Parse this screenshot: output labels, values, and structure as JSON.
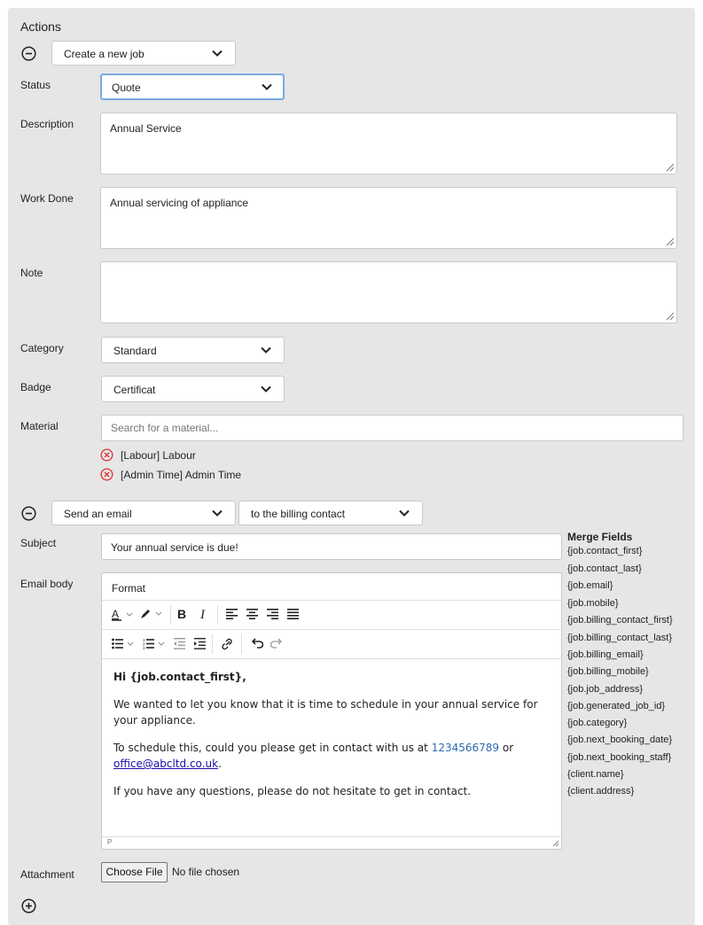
{
  "section_title": "Actions",
  "action1": {
    "select_value": "Create a new job"
  },
  "job_form": {
    "status": {
      "label": "Status",
      "value": "Quote"
    },
    "description": {
      "label": "Description",
      "value": "Annual Service"
    },
    "work_done": {
      "label": "Work Done",
      "value": "Annual servicing of appliance"
    },
    "note": {
      "label": "Note",
      "value": ""
    },
    "category": {
      "label": "Category",
      "value": "Standard"
    },
    "badge": {
      "label": "Badge",
      "value": "Certificat"
    },
    "material": {
      "label": "Material",
      "placeholder": "Search for a material...",
      "items": [
        "[Labour] Labour",
        "[Admin Time] Admin Time"
      ]
    }
  },
  "action2": {
    "select_value": "Send an email",
    "recipient_value": "to the billing contact"
  },
  "email_form": {
    "subject": {
      "label": "Subject",
      "value": "Your annual service is due!"
    },
    "body": {
      "label": "Email body",
      "format_label": "Format",
      "status_path": "P",
      "greeting": "Hi {job.contact_first},",
      "para1": "We wanted to let you know that it is time to schedule in your annual service for your appliance.",
      "para2_prefix": "To schedule this, could you please get in contact with us at ",
      "phone": "1234566789",
      "para2_mid": " or ",
      "email_link": "office@abcltd.co.uk",
      "para2_suffix": ".",
      "para3": "If you have any questions, please do not hesitate to get in contact."
    },
    "attachment": {
      "label": "Attachment",
      "button": "Choose File",
      "status": "No file chosen"
    }
  },
  "merge_fields": {
    "title": "Merge Fields",
    "items": [
      "{job.contact_first}",
      "{job.contact_last}",
      "{job.email}",
      "{job.mobile}",
      "{job.billing_contact_first}",
      "{job.billing_contact_last}",
      "{job.billing_email}",
      "{job.billing_mobile}",
      "{job.job_address}",
      "{job.generated_job_id}",
      "{job.category}",
      "{job.next_booking_date}",
      "{job.next_booking_staff}",
      "{client.name}",
      "{client.address}"
    ]
  },
  "colors": {
    "panel_bg": "#e6e6e6",
    "remove_icon_red": "#e03c3c",
    "link_blue": "#1a0dab",
    "phone_blue": "#2b6cb0",
    "focus_ring": "#7aa9e0"
  },
  "icons": [
    "minus-circle-icon",
    "chevron-down-icon",
    "remove-circle-icon",
    "plus-circle-icon",
    "resize-grip-icon",
    "text-color-icon",
    "highlight-icon",
    "bold-icon",
    "italic-icon",
    "align-left-icon",
    "align-center-icon",
    "align-right-icon",
    "justify-icon",
    "bullet-list-icon",
    "numbered-list-icon",
    "outdent-icon",
    "indent-icon",
    "link-icon",
    "undo-icon",
    "redo-icon"
  ]
}
